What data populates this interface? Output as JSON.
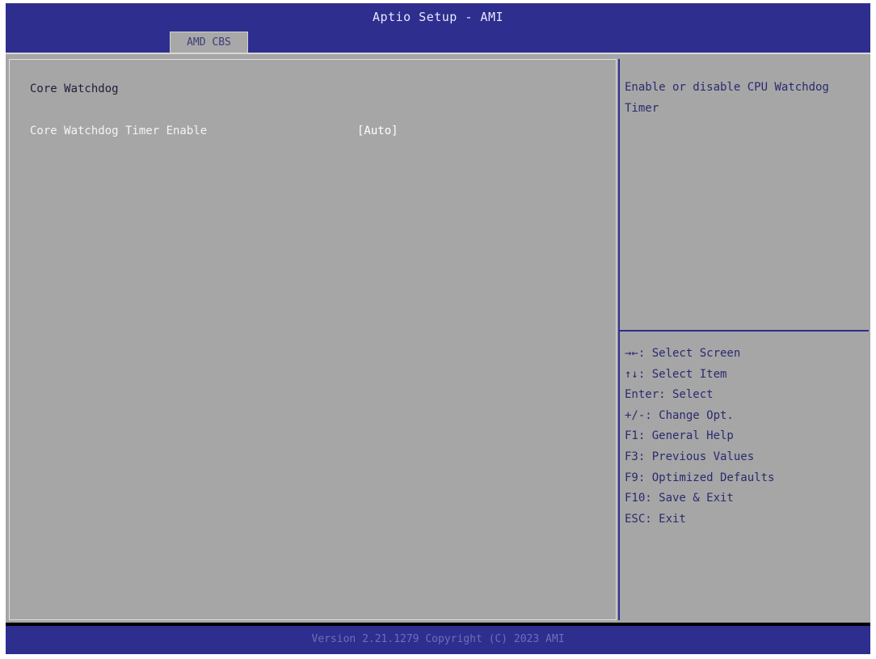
{
  "header": {
    "title": "Aptio Setup - AMI",
    "tabs": [
      {
        "label": "AMD CBS",
        "active": true
      }
    ]
  },
  "main": {
    "section_title": "Core Watchdog",
    "settings": [
      {
        "label": "Core Watchdog Timer Enable",
        "value": "[Auto]"
      }
    ]
  },
  "help": {
    "description": "Enable or disable CPU Watchdog Timer"
  },
  "keys": [
    "→←: Select Screen",
    "↑↓: Select Item",
    "Enter: Select",
    "+/-: Change Opt.",
    "F1: General Help",
    "F3: Previous Values",
    "F9: Optimized Defaults",
    "F10: Save & Exit",
    "ESC: Exit"
  ],
  "footer": {
    "text": "Version 2.21.1279 Copyright (C) 2023 AMI"
  },
  "colors": {
    "header_bg": "#2e2e8e",
    "panel_bg": "#a6a6a6",
    "help_text": "#2a2a70",
    "selected_text": "#ffffff"
  }
}
